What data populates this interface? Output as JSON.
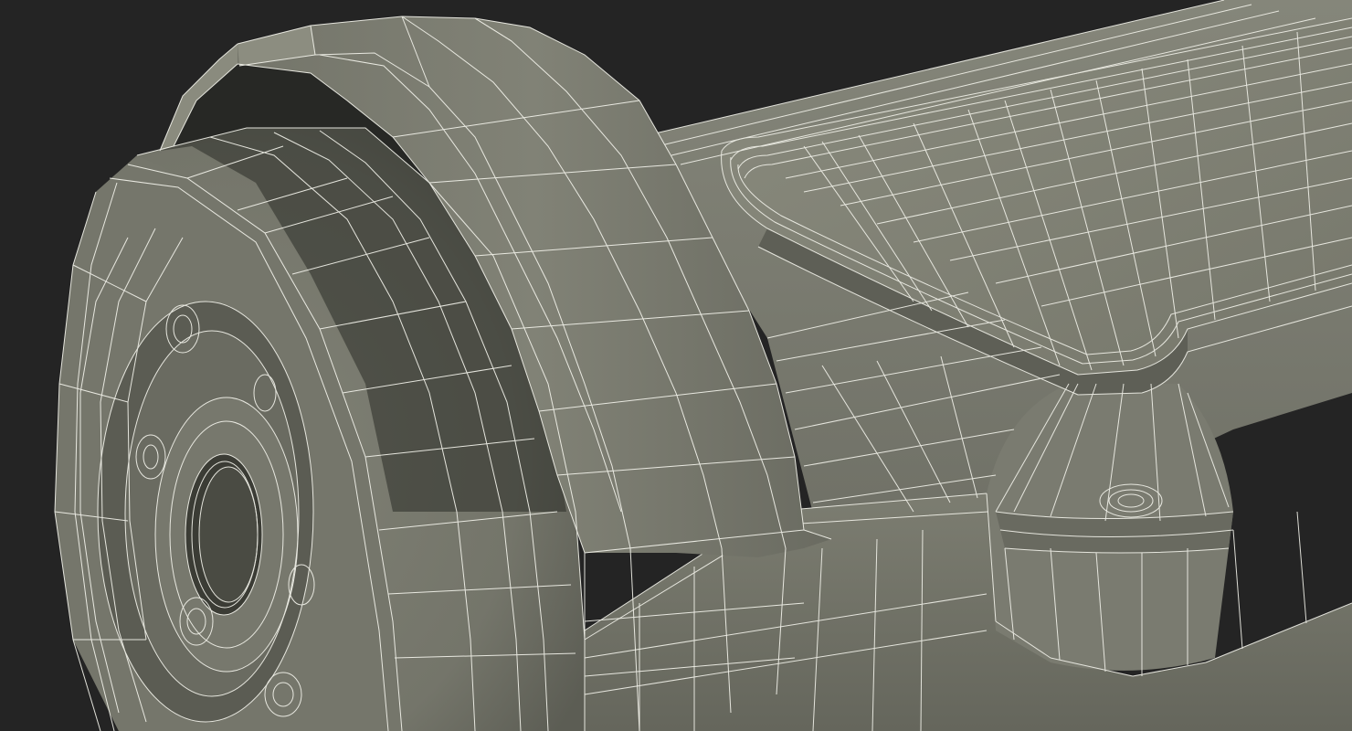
{
  "scene": {
    "subject": "hoverboard-wireframe-render",
    "colors": {
      "background": "#242424",
      "surface": "#7b7c6f",
      "surface_light": "#86877a",
      "surface_dark": "#5f6056",
      "shadow": "#3c3d36",
      "deep_shadow": "#1f201c",
      "wire": "#f1f1ea"
    }
  }
}
